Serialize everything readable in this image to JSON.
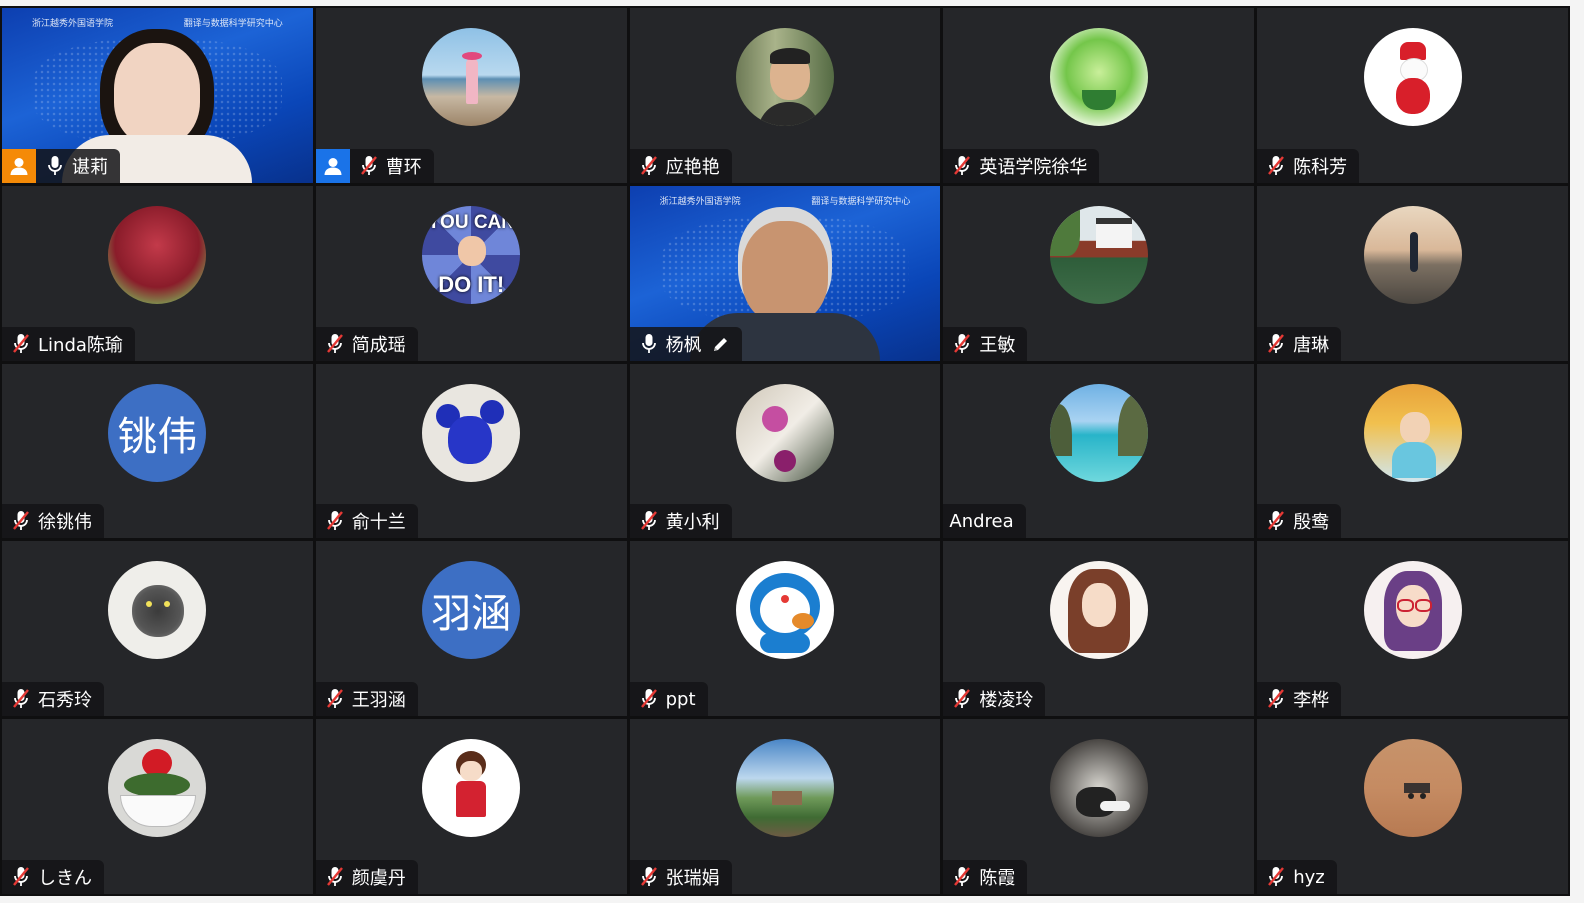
{
  "participants": [
    {
      "name": "谌莉",
      "mic": "on",
      "host_badge": "orange",
      "video": "woman"
    },
    {
      "name": "曹环",
      "mic": "muted",
      "host_badge": "blue",
      "avatar": "beach-photo"
    },
    {
      "name": "应艳艳",
      "mic": "muted",
      "avatar": "boy-photo"
    },
    {
      "name": "英语学院徐华",
      "mic": "muted",
      "avatar": "plant-photo"
    },
    {
      "name": "陈科芳",
      "mic": "muted",
      "avatar": "snowman-photo"
    },
    {
      "name": "Linda陈瑜",
      "mic": "muted",
      "avatar": "tree-photo"
    },
    {
      "name": "简成瑶",
      "mic": "muted",
      "avatar": "meme-photo",
      "meme_top": "YOU CAN",
      "meme_bottom": "DO IT!"
    },
    {
      "name": "杨枫",
      "mic": "on",
      "active": true,
      "pen": true,
      "video": "man"
    },
    {
      "name": "王敏",
      "mic": "muted",
      "avatar": "pavilion-photo"
    },
    {
      "name": "唐琳",
      "mic": "muted",
      "avatar": "sunset-photo"
    },
    {
      "name": "徐铫伟",
      "mic": "muted",
      "initials": "铫伟"
    },
    {
      "name": "俞十兰",
      "mic": "muted",
      "avatar": "mouse-toy-photo"
    },
    {
      "name": "黄小利",
      "mic": "muted",
      "avatar": "flower-photo"
    },
    {
      "name": "Andrea",
      "mic": "none",
      "avatar": "sea-photo"
    },
    {
      "name": "殷鸯",
      "mic": "muted",
      "avatar": "child-photo"
    },
    {
      "name": "石秀玲",
      "mic": "muted",
      "avatar": "cat-drawing"
    },
    {
      "name": "王羽涵",
      "mic": "muted",
      "initials": "羽涵"
    },
    {
      "name": "ppt",
      "mic": "muted",
      "avatar": "doraemon"
    },
    {
      "name": "楼凌玲",
      "mic": "muted",
      "avatar": "girl-drawing"
    },
    {
      "name": "李桦",
      "mic": "muted",
      "avatar": "glasses-girl-drawing"
    },
    {
      "name": "しきん",
      "mic": "muted",
      "avatar": "rose-photo"
    },
    {
      "name": "颜虞丹",
      "mic": "muted",
      "avatar": "cartoon-girl"
    },
    {
      "name": "张瑞娟",
      "mic": "muted",
      "avatar": "landscape-photo"
    },
    {
      "name": "陈霞",
      "mic": "muted",
      "avatar": "yoga-photo"
    },
    {
      "name": "hyz",
      "mic": "muted",
      "avatar": "mars-rover-photo"
    }
  ],
  "video_banner": {
    "left": "浙江越秀外国语学院",
    "right": "翻译与数据科学研究中心"
  },
  "colors": {
    "tile": "#252629",
    "active_border": "#23d05a",
    "host_orange": "#f58a07",
    "host_blue": "#1a73e8",
    "initials_bg": "#3d6fc4",
    "muted_icon": "#e53935"
  }
}
